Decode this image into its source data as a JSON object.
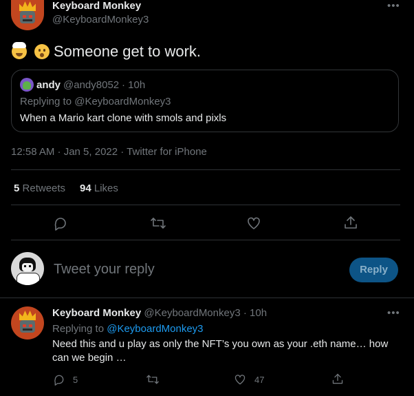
{
  "tweet": {
    "author_name": "Keyboard Monkey",
    "author_handle": "@KeyboardMonkey3",
    "text": "Someone get to work.",
    "timestamp": "12:58 AM · Jan 5, 2022 · Twitter for iPhone"
  },
  "quote": {
    "author_name": "andy",
    "author_handle": "@andy8052",
    "time": "· 10h",
    "replying_to": "Replying to @KeyboardMonkey3",
    "text": "When a Mario kart clone with smols and pixls"
  },
  "stats": {
    "retweets_count": "5",
    "retweets_label": "Retweets",
    "likes_count": "94",
    "likes_label": "Likes"
  },
  "composer": {
    "placeholder": "Tweet your reply",
    "reply_button": "Reply"
  },
  "reply": {
    "author_name": "Keyboard Monkey",
    "author_handle": "@KeyboardMonkey3",
    "time": "· 10h",
    "replying_prefix": "Replying to",
    "replying_handle": "@KeyboardMonkey3",
    "text_line1": "Need this and u play as only the NFT’s you own as your .eth name… how",
    "text_line2": "can we begin …",
    "reply_count": "5",
    "like_count": "47"
  },
  "more_glyph": "•••",
  "icons": [
    "exploding-head-emoji",
    "astonished-face-emoji",
    "reply-icon",
    "retweet-icon",
    "like-icon",
    "share-icon",
    "more-icon"
  ],
  "colors": {
    "background": "#000000",
    "text": "#e7e9ea",
    "muted": "#71767b",
    "link": "#1d9bf0",
    "reply_button": "#0d5486"
  }
}
